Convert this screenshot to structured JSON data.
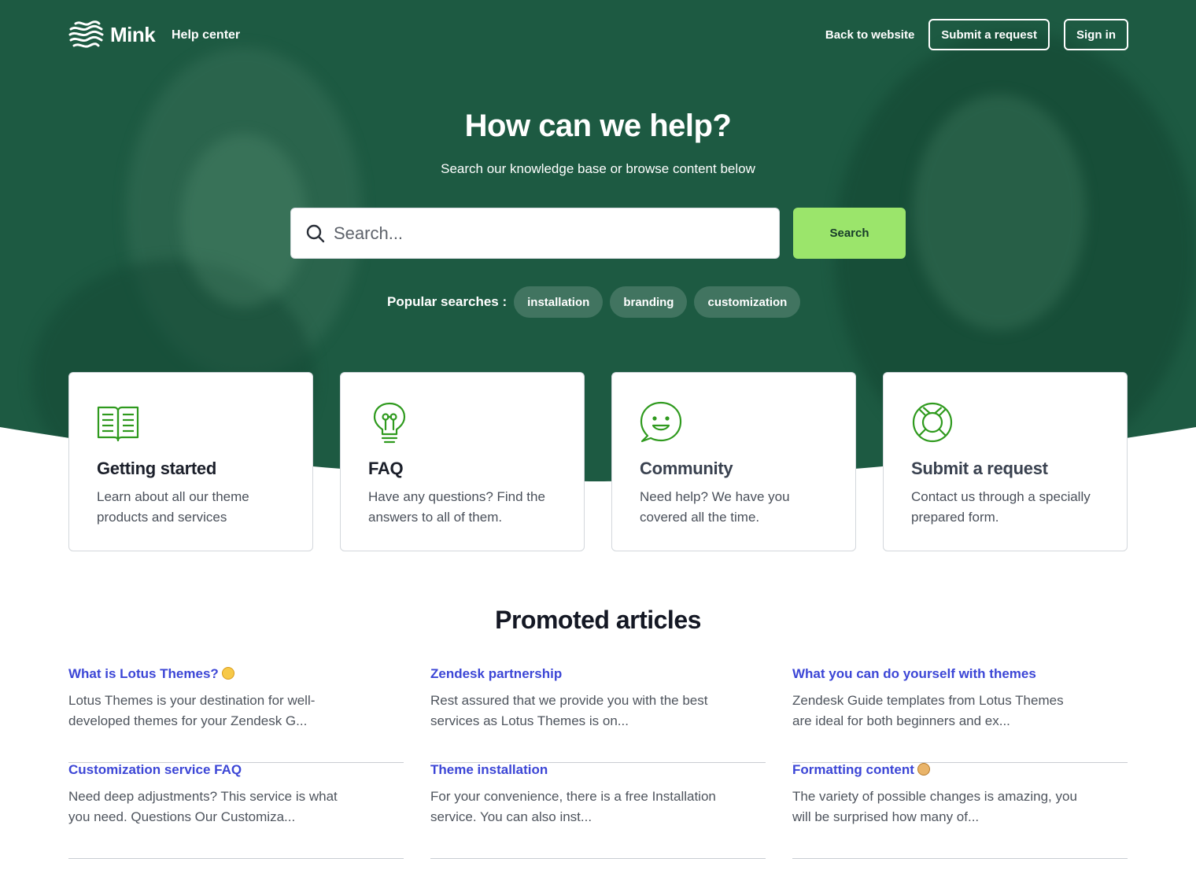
{
  "header": {
    "brand": "Mink",
    "section": "Help center",
    "nav": {
      "back_link": "Back to website",
      "submit_button": "Submit a request",
      "signin_button": "Sign in"
    }
  },
  "hero": {
    "title": "How can we help?",
    "subtitle": "Search our knowledge base or browse content below",
    "search": {
      "placeholder": "Search...",
      "button": "Search"
    },
    "popular": {
      "label": "Popular searches :",
      "chips": [
        "installation",
        "branding",
        "customization"
      ]
    }
  },
  "cards": [
    {
      "icon": "open-book-icon",
      "title": "Getting started",
      "description": "Learn about all our theme products and services"
    },
    {
      "icon": "lightbulb-icon",
      "title": "FAQ",
      "description": "Have any questions? Find the answers to all of them."
    },
    {
      "icon": "chat-bubble-icon",
      "title": "Community",
      "description": "Need help? We have you covered all the time."
    },
    {
      "icon": "lifebuoy-icon",
      "title": "Submit a request",
      "description": "Contact us through a specially prepared form."
    }
  ],
  "promoted": {
    "title": "Promoted articles",
    "articles": [
      {
        "title": "What is Lotus Themes?",
        "emoji": "smiling-face-emoji",
        "excerpt": "Lotus Themes is your destination for well-developed themes for your Zendesk G..."
      },
      {
        "title": "Zendesk partnership",
        "excerpt": "Rest assured that we provide you with the best services as Lotus Themes is on..."
      },
      {
        "title": "What you can do yourself with themes",
        "excerpt": "Zendesk Guide templates from Lotus Themes are ideal for both beginners and ex..."
      },
      {
        "title": "Customization service FAQ",
        "excerpt": "Need deep adjustments? This service is what you need. Questions Our Customiza..."
      },
      {
        "title": "Theme installation",
        "excerpt": "For your convenience, there is a free Installation service. You can also inst..."
      },
      {
        "title": "Formatting content",
        "emoji": "palette-emoji",
        "excerpt": "The variety of possible changes is amazing, you will be surprised how many of..."
      }
    ]
  },
  "colors": {
    "hero_green": "#1d5a42",
    "accent_green": "#9be56b",
    "icon_green": "#2f9a1e",
    "link_blue": "#3c46d6"
  }
}
